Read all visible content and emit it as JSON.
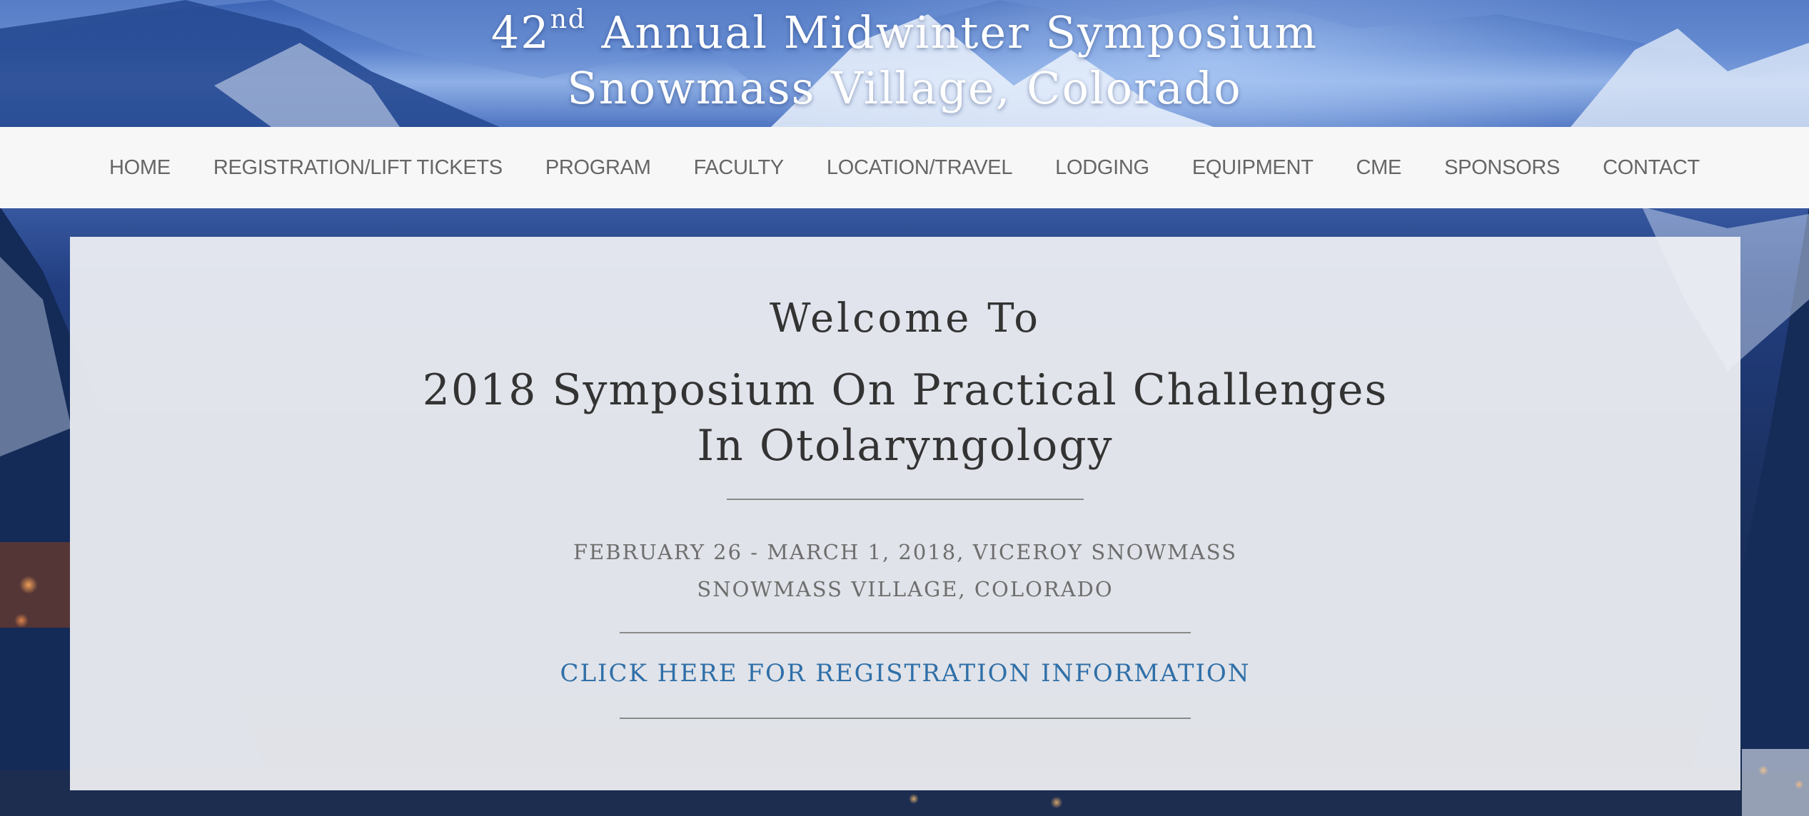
{
  "header": {
    "title_prefix": "42",
    "title_superscript": "nd",
    "title_suffix": " Annual Midwinter Symposium",
    "location": "Snowmass Village, Colorado"
  },
  "nav": {
    "items": [
      {
        "label": "HOME"
      },
      {
        "label": "REGISTRATION/LIFT TICKETS"
      },
      {
        "label": "PROGRAM"
      },
      {
        "label": "FACULTY"
      },
      {
        "label": "LOCATION/TRAVEL"
      },
      {
        "label": "LODGING"
      },
      {
        "label": "EQUIPMENT"
      },
      {
        "label": "CME"
      },
      {
        "label": "SPONSORS"
      },
      {
        "label": "CONTACT"
      }
    ]
  },
  "main": {
    "welcome": "Welcome To",
    "title_line1": "2018 Symposium On Practical Challenges",
    "title_line2": "In Otolaryngology",
    "dates_line1": "FEBRUARY 26 - MARCH 1, 2018, VICEROY SNOWMASS",
    "dates_line2": "SNOWMASS VILLAGE, COLORADO",
    "registration_link": "CLICK HERE FOR REGISTRATION INFORMATION"
  },
  "colors": {
    "nav_background": "#f7f7f7",
    "nav_text": "#666666",
    "heading_text": "#333333",
    "link": "#2f6fa8",
    "panel_background": "#f0f1f4"
  }
}
